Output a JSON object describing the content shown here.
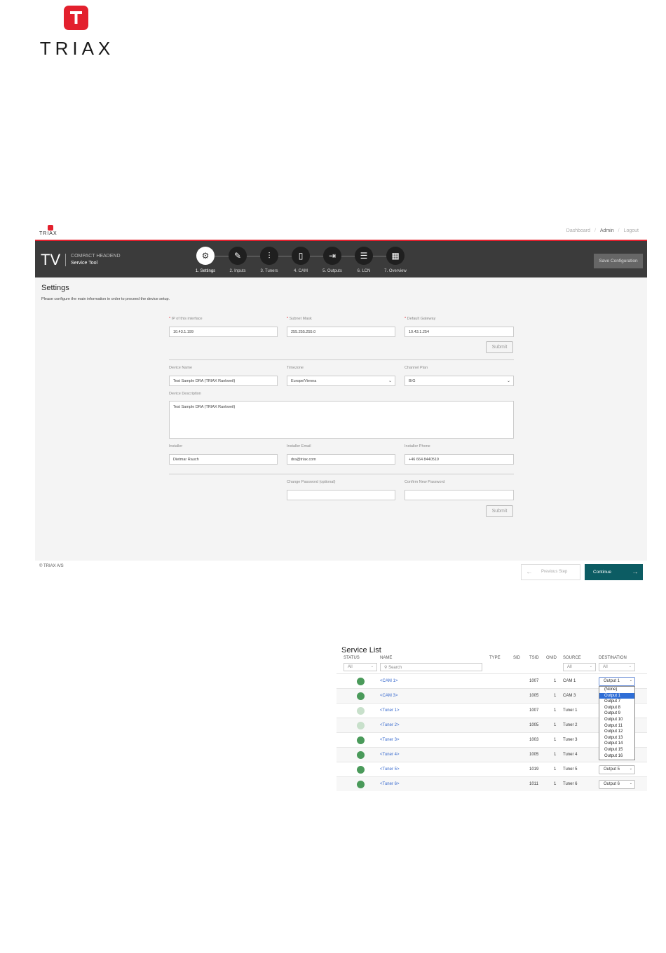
{
  "page_logo": {
    "letter": "T",
    "word": "TRIAX"
  },
  "app": {
    "mini_logo": {
      "word": "TRIAX"
    },
    "top_links": [
      "Dashboard",
      "Admin",
      "Logout"
    ],
    "brand": {
      "tv": "TV",
      "line1": "COMPACT HEADEND",
      "line2": "Service Tool"
    },
    "steps": [
      {
        "label": "1. Settings",
        "icon": "gear-icon"
      },
      {
        "label": "2. Inputs",
        "icon": "feather-icon"
      },
      {
        "label": "3. Tuners",
        "icon": "sliders-icon"
      },
      {
        "label": "4. CAM",
        "icon": "cam-card-icon"
      },
      {
        "label": "5. Outputs",
        "icon": "output-arrow-icon"
      },
      {
        "label": "6. LCN",
        "icon": "list-icon"
      },
      {
        "label": "7. Overview",
        "icon": "grid-icon"
      }
    ],
    "save_configuration": "Save Configuration",
    "settings": {
      "title": "Settings",
      "intro": "Please configure the main information in order to proceed the device setup.",
      "ip_label": "IP of this interface",
      "ip_value": "10.43.1.199",
      "subnet_label": "Subnet Mask",
      "subnet_value": "255.255.255.0",
      "gateway_label": "Default Gateway",
      "gateway_value": "10.43.1.254",
      "submit1": "Submit",
      "device_name_label": "Device Name",
      "device_name_value": "Test Sample DRA (TRIAX Rankweil)",
      "timezone_label": "Timezone",
      "timezone_value": "Europe/Vienna",
      "channel_plan_label": "Channel Plan",
      "channel_plan_value": "B/G",
      "device_desc_label": "Device Description",
      "device_desc_value": "Test Sample DRA (TRIAX Rankweil)",
      "installer_label": "Installer",
      "installer_value": "Dietmar Rauch",
      "installer_email_label": "Installer Email",
      "installer_email_value": "dra@triax.com",
      "installer_phone_label": "Installer Phone",
      "installer_phone_value": "+46 664 8440519",
      "change_pw_label": "Change Password (optional)",
      "confirm_pw_label": "Confirm New Password",
      "submit2": "Submit"
    },
    "footer": {
      "copyright": "© TRIAX A/S",
      "previous": "Previous Step",
      "continue": "Continue"
    }
  },
  "service_list": {
    "title": "Service List",
    "headers": [
      "STATUS",
      "NAME",
      "TYPE",
      "SID",
      "TSID",
      "ONID",
      "SOURCE",
      "DESTINATION"
    ],
    "filters": {
      "status": "All",
      "search": "Search",
      "source": "All",
      "destination": "All"
    },
    "rows": [
      {
        "name": "<CAM 1>",
        "tsid": "1007",
        "onid": "1",
        "source": "CAM 1",
        "destination": "Output 1",
        "status": "active"
      },
      {
        "name": "<CAM 3>",
        "tsid": "1005",
        "onid": "1",
        "source": "CAM 3",
        "destination": "",
        "status": "active"
      },
      {
        "name": "<Tuner 1>",
        "tsid": "1007",
        "onid": "1",
        "source": "Tuner 1",
        "destination": "",
        "status": "inactive"
      },
      {
        "name": "<Tuner 2>",
        "tsid": "1005",
        "onid": "1",
        "source": "Tuner 2",
        "destination": "",
        "status": "inactive"
      },
      {
        "name": "<Tuner 3>",
        "tsid": "1003",
        "onid": "1",
        "source": "Tuner 3",
        "destination": "",
        "status": "active"
      },
      {
        "name": "<Tuner 4>",
        "tsid": "1005",
        "onid": "1",
        "source": "Tuner 4",
        "destination": "",
        "status": "active"
      },
      {
        "name": "<Tuner 5>",
        "tsid": "1019",
        "onid": "1",
        "source": "Tuner 5",
        "destination": "Output 5",
        "status": "active"
      },
      {
        "name": "<Tuner 6>",
        "tsid": "1011",
        "onid": "1",
        "source": "Tuner 6",
        "destination": "Output 6",
        "status": "active"
      }
    ],
    "dropdown_options": [
      "(None)",
      "Output 1",
      "Output 7",
      "Output 8",
      "Output 9",
      "Output 10",
      "Output 11",
      "Output 12",
      "Output 13",
      "Output 14",
      "Output 15",
      "Output 16"
    ],
    "dropdown_selected": "Output 1"
  }
}
